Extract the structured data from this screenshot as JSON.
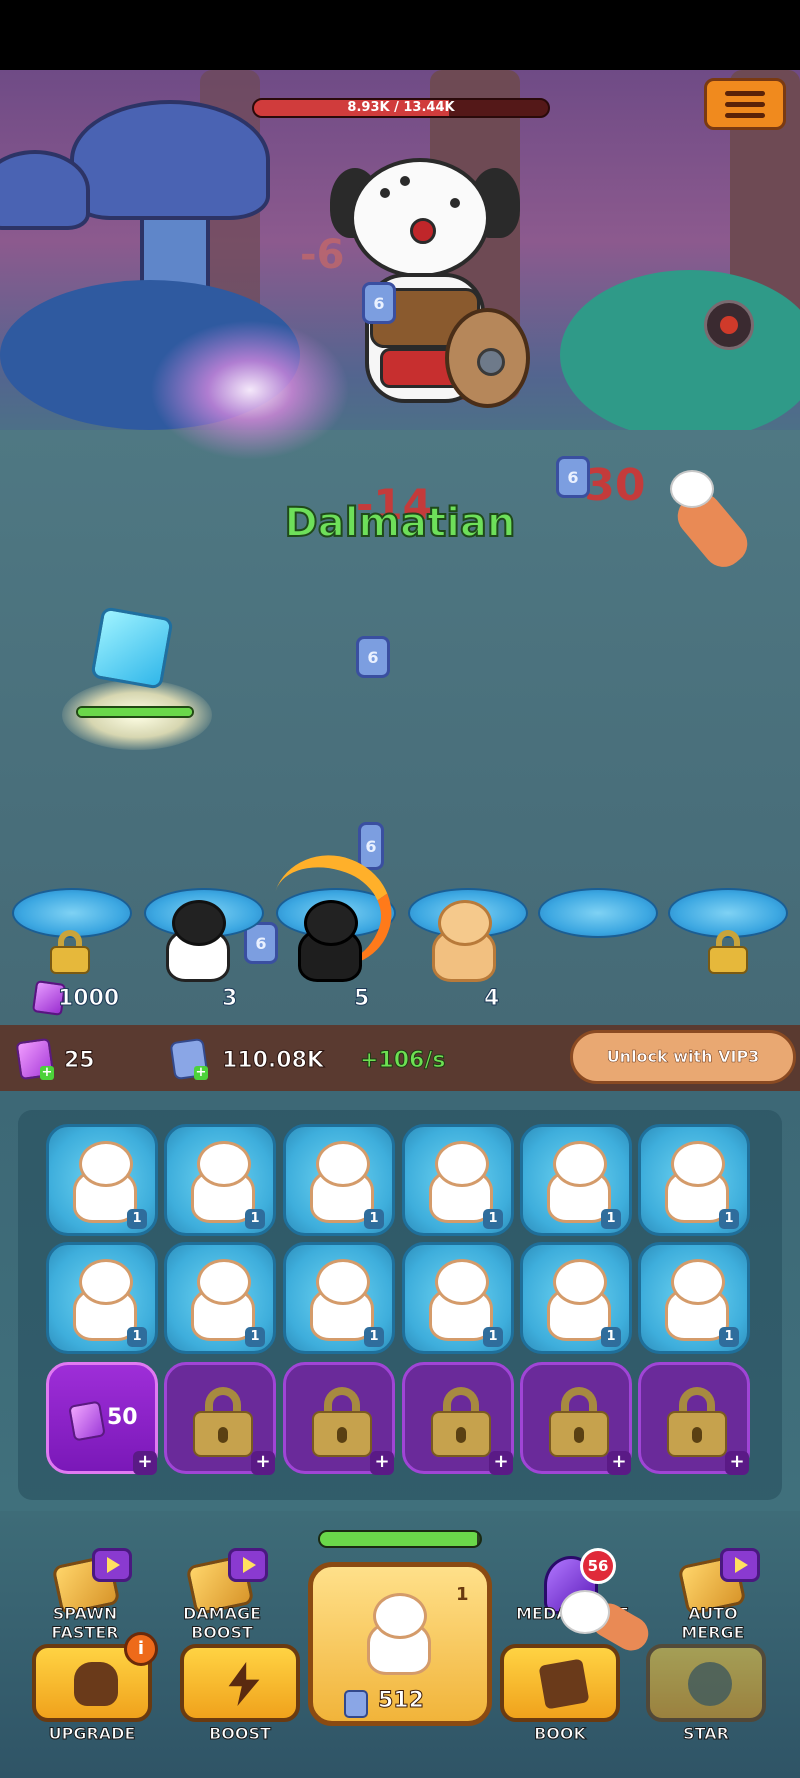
{
  "boss": {
    "hp_text": "8.93K / 13.44K",
    "hp_fraction": 0.664,
    "name": "Dalmatian"
  },
  "damage_numbers": [
    "-14",
    "-30",
    "-6"
  ],
  "spawn_pads": {
    "unlock_cost": "1000",
    "cat_levels": [
      "3",
      "5",
      "4"
    ]
  },
  "resources": {
    "gems": "25",
    "tokens": "110.08K",
    "rate": "+106/s",
    "vip_button": "Unlock with VIP3"
  },
  "grid": {
    "cat_levels": [
      "1",
      "1",
      "1",
      "1",
      "1",
      "1",
      "1",
      "1",
      "1",
      "1",
      "1",
      "1"
    ],
    "gem_slot_cost": "50",
    "plus": "+"
  },
  "bottom": {
    "spawn_faster": "SPAWN FASTER",
    "damage_boost": "DAMAGE BOOST",
    "medal": "MEDAL",
    "medal_suffix": "E",
    "medal_badge": "56",
    "auto_merge": "AUTO MERGE",
    "upgrade": "UPGRADE",
    "upgrade_badge": "i",
    "boost": "BOOST",
    "book": "BOOK",
    "star": "STAR",
    "spawn_level": "1",
    "spawn_cost": "512",
    "spawn_progress": 0.98
  },
  "colors": {
    "name_green": "#6ee05a",
    "damage_red": "#c43b3b",
    "gold": "#ffd343",
    "purple_slot": "#7a18b8"
  }
}
